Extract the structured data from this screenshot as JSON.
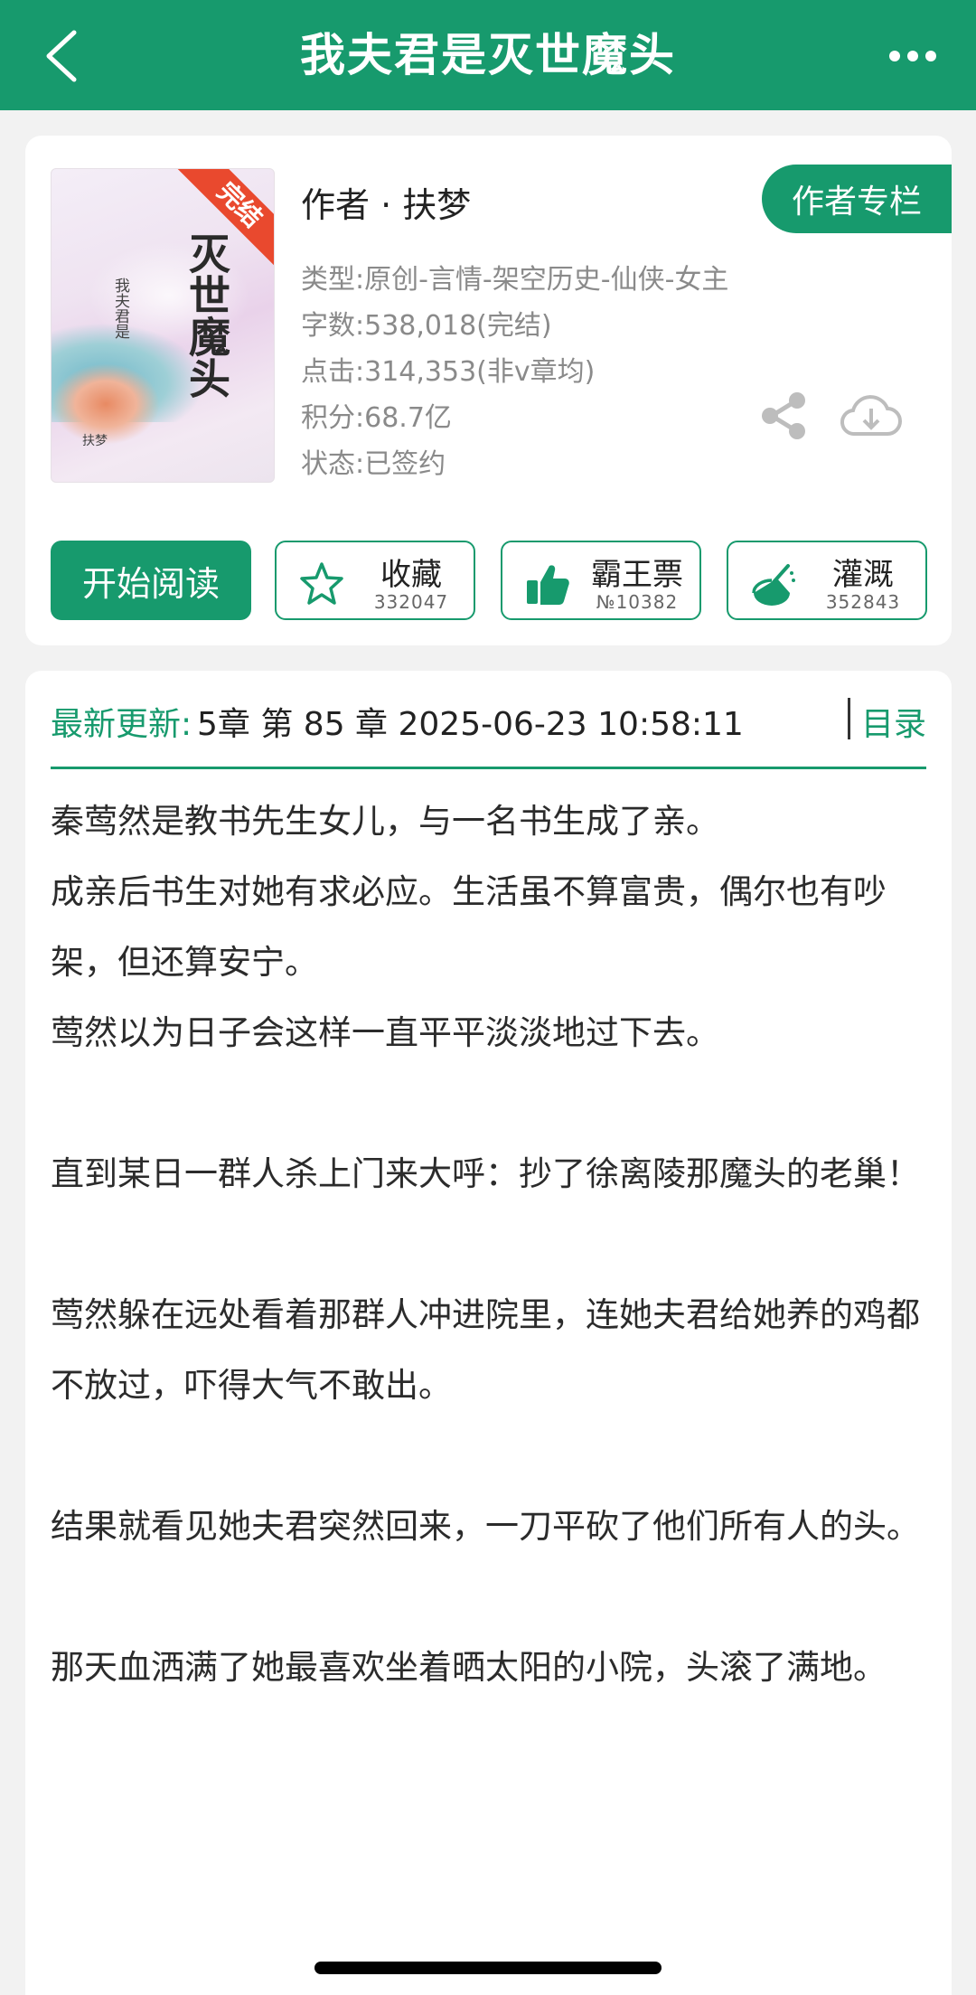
{
  "header": {
    "title": "我夫君是灭世魔头"
  },
  "book": {
    "cover_badge": "完结",
    "cover_title": "灭世魔头",
    "cover_subtitle": "我夫君是",
    "cover_author": "扶梦",
    "author_line": "作者 · 扶梦",
    "author_column_label": "作者专栏",
    "meta": [
      "类型:原创-言情-架空历史-仙侠-女主",
      "字数:538,018(完结)",
      "点击:314,353(非v章均)",
      "积分:68.7亿",
      "状态:已签约"
    ]
  },
  "actions": {
    "start_reading": "开始阅读",
    "favorite": {
      "label": "收藏",
      "count": "332047"
    },
    "ticket": {
      "label": "霸王票",
      "count": "№10382"
    },
    "water": {
      "label": "灌溉",
      "count": "352843"
    }
  },
  "update": {
    "label": "最新更新:",
    "text": "5章 第 85 章 2025-06-23 10:58:11",
    "toc": "目录"
  },
  "synopsis": [
    "秦莺然是教书先生女儿，与一名书生成了亲。",
    "成亲后书生对她有求必应。生活虽不算富贵，偶尔也有吵架，但还算安宁。",
    "莺然以为日子会这样一直平平淡淡地过下去。",
    "",
    "直到某日一群人杀上门来大呼：抄了徐离陵那魔头的老巢！",
    "",
    "莺然躲在远处看着那群人冲进院里，连她夫君给她养的鸡都不放过，吓得大气不敢出。",
    "",
    "结果就看见她夫君突然回来，一刀平砍了他们所有人的头。",
    "",
    "那天血洒满了她最喜欢坐着晒太阳的小院，头滚了满地。",
    ""
  ],
  "colors": {
    "brand_green": "#179a6d",
    "badge_red": "#e9492e"
  }
}
